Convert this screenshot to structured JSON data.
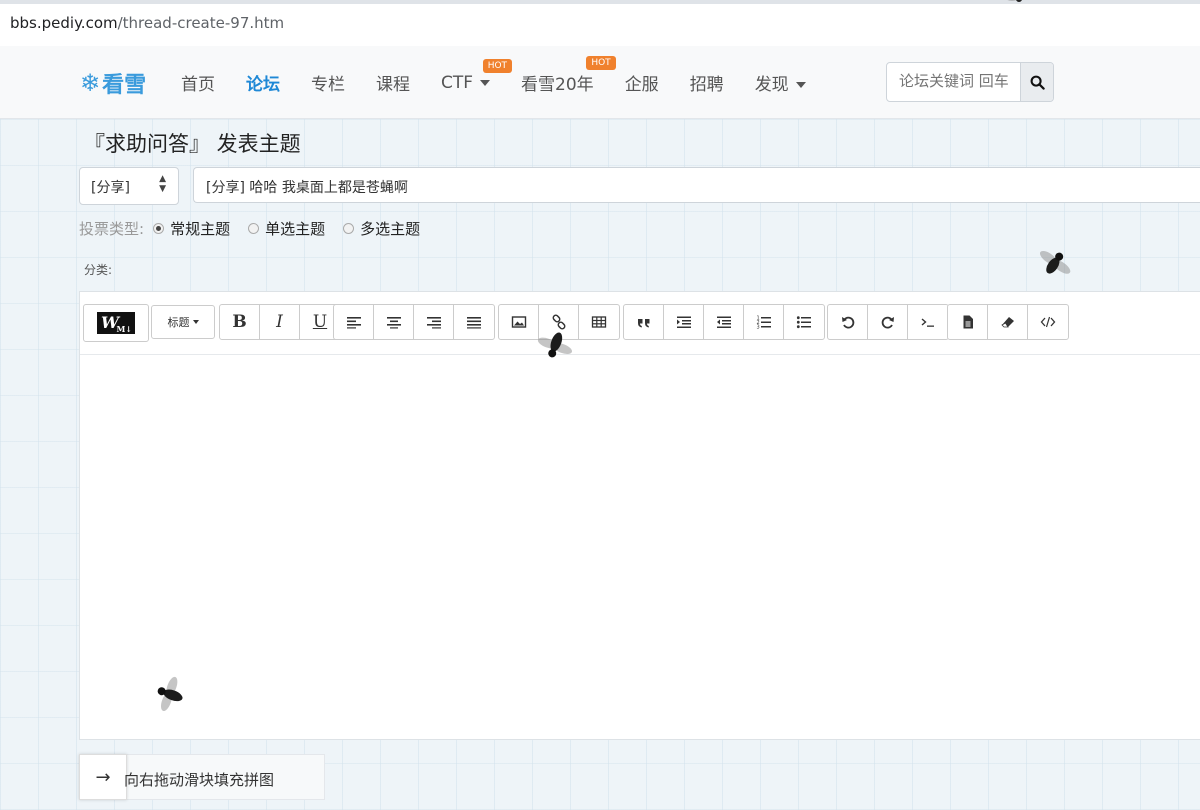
{
  "browser": {
    "url_domain": "bbs.pediy.com",
    "url_path": "/thread-create-97.htm"
  },
  "nav": {
    "logo_text": "看雪",
    "items": [
      {
        "label": "首页",
        "active": false,
        "dropdown": false,
        "hot": false
      },
      {
        "label": "论坛",
        "active": true,
        "dropdown": false,
        "hot": false
      },
      {
        "label": "专栏",
        "active": false,
        "dropdown": false,
        "hot": false
      },
      {
        "label": "课程",
        "active": false,
        "dropdown": false,
        "hot": false
      },
      {
        "label": "CTF",
        "active": false,
        "dropdown": true,
        "hot": true
      },
      {
        "label": "看雪20年",
        "active": false,
        "dropdown": false,
        "hot": true
      },
      {
        "label": "企服",
        "active": false,
        "dropdown": false,
        "hot": false
      },
      {
        "label": "招聘",
        "active": false,
        "dropdown": false,
        "hot": false
      },
      {
        "label": "发现",
        "active": false,
        "dropdown": true,
        "hot": false
      }
    ],
    "hot_badge": "HOT",
    "search_placeholder": "论坛关键词 回车"
  },
  "form": {
    "page_title": "『求助问答』 发表主题",
    "category_select": "[分享]",
    "subject_value": "[分享] 哈哈  我桌面上都是苍蝇啊",
    "vote_label": "投票类型:",
    "vote_options": [
      {
        "label": "常规主题",
        "selected": true
      },
      {
        "label": "单选主题",
        "selected": false
      },
      {
        "label": "多选主题",
        "selected": false
      }
    ],
    "category_label": "分类:"
  },
  "editor": {
    "heading_button": "标题",
    "toolbar_icons": [
      "bold-icon",
      "italic-icon",
      "underline-icon",
      "align-left-icon",
      "align-center-icon",
      "align-right-icon",
      "align-justify-icon",
      "image-icon",
      "link-icon",
      "table-icon",
      "quote-icon",
      "indent-icon",
      "outdent-icon",
      "ordered-list-icon",
      "unordered-list-icon",
      "undo-icon",
      "redo-icon",
      "code-icon",
      "file-icon",
      "eraser-icon",
      "html-source-icon"
    ],
    "bold_label": "B",
    "italic_label": "I",
    "underline_label": "U"
  },
  "captcha": {
    "arrow": "→",
    "text": "向右拖动滑块填充拼图"
  },
  "colors": {
    "accent": "#1e88d6",
    "logo": "#3a9bdc",
    "hot_badge": "#f0812d"
  }
}
